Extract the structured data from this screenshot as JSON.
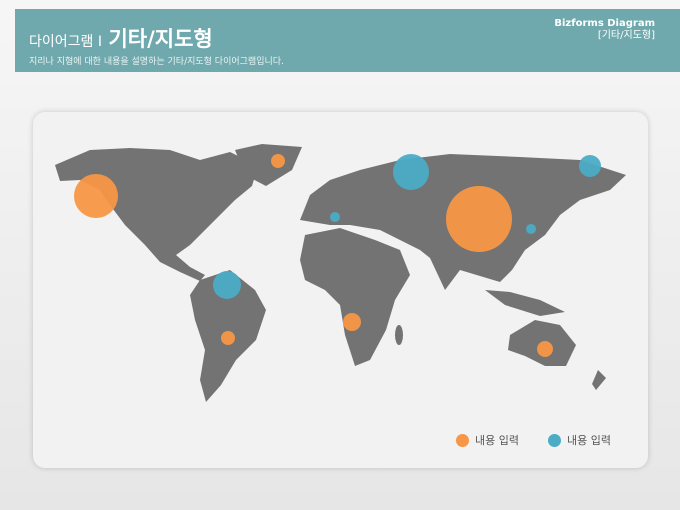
{
  "header": {
    "prefix": "다이어그램 I",
    "title": "기타/지도형",
    "subtitle": "지리나 지형에 대한 내용을 설명하는 기타/지도형 다이어그램입니다.",
    "brand": "Bizforms Diagram",
    "brand_sub": "[기타/지도형]"
  },
  "colors": {
    "orange": "#f79646",
    "blue": "#4bacc6",
    "land": "#737373",
    "header": "#70a9ad"
  },
  "legend": [
    {
      "label": "내용 입력",
      "color": "#f79646"
    },
    {
      "label": "내용 입력",
      "color": "#4bacc6"
    }
  ],
  "bubbles": [
    {
      "region": "north-america-west",
      "series": "orange",
      "size": 22
    },
    {
      "region": "greenland",
      "series": "orange",
      "size": 7
    },
    {
      "region": "russia-west",
      "series": "blue",
      "size": 18
    },
    {
      "region": "mediterranean",
      "series": "blue",
      "size": 5
    },
    {
      "region": "china",
      "series": "orange",
      "size": 33
    },
    {
      "region": "korea",
      "series": "blue",
      "size": 5
    },
    {
      "region": "russia-east",
      "series": "blue",
      "size": 11
    },
    {
      "region": "northern-south-america",
      "series": "blue",
      "size": 14
    },
    {
      "region": "southern-south-america",
      "series": "orange",
      "size": 7
    },
    {
      "region": "southern-africa",
      "series": "orange",
      "size": 9
    },
    {
      "region": "australia",
      "series": "orange",
      "size": 8
    }
  ]
}
